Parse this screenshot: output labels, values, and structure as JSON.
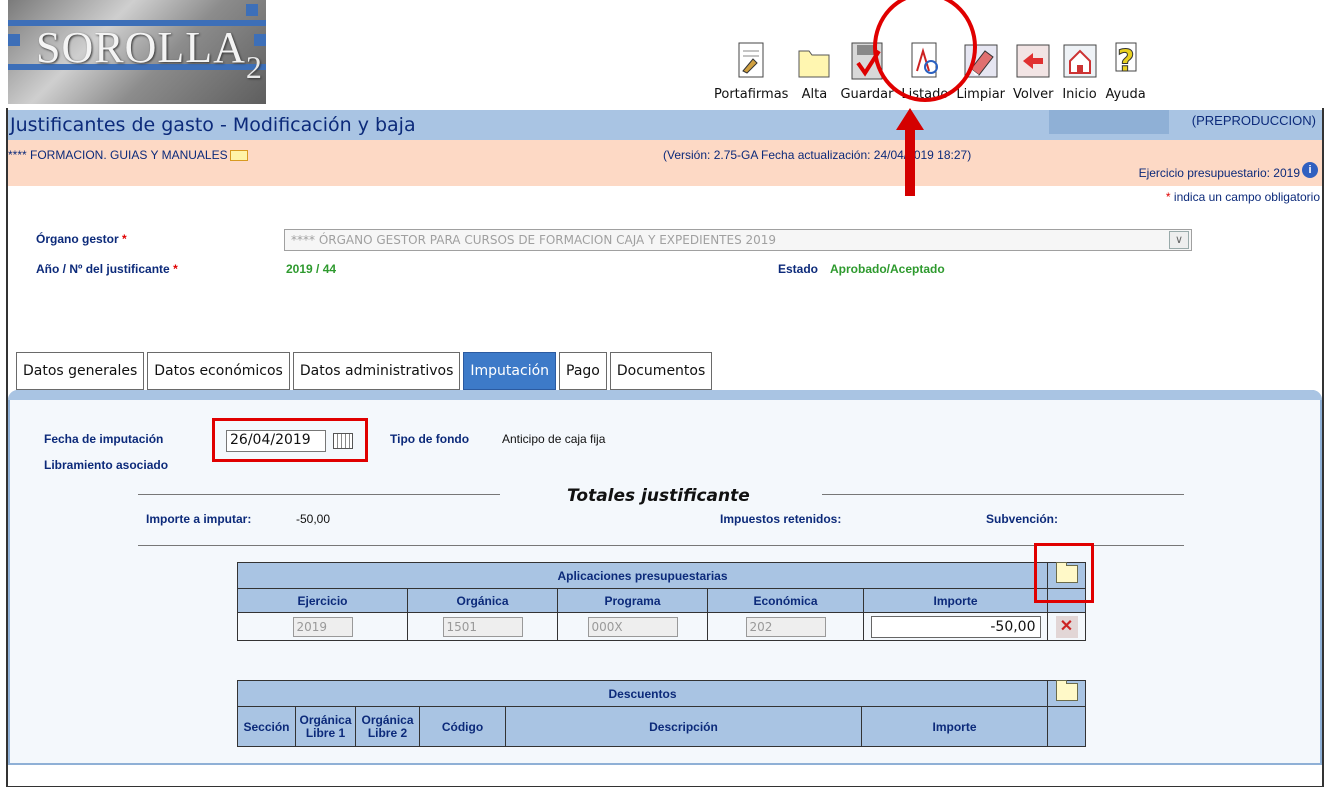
{
  "logo": {
    "text": "SOROLLA",
    "version_mark": "2"
  },
  "toolbar": {
    "items": [
      {
        "label": "Portafirmas",
        "icon": "signature-pad-icon"
      },
      {
        "label": "Alta",
        "icon": "folder-icon"
      },
      {
        "label": "Guardar",
        "icon": "save-check-icon"
      },
      {
        "label": "Listado",
        "icon": "document-list-icon"
      },
      {
        "label": "Limpiar",
        "icon": "eraser-icon"
      },
      {
        "label": "Volver",
        "icon": "back-arrow-icon"
      },
      {
        "label": "Inicio",
        "icon": "home-icon"
      },
      {
        "label": "Ayuda",
        "icon": "help-icon"
      }
    ]
  },
  "title": {
    "text": "Justificantes de gasto - Modificación y baja",
    "environment": "(PREPRODUCCION)"
  },
  "info": {
    "user_text": "**** FORMACION. GUIAS Y MANUALES",
    "version": "(Versión: 2.75-GA Fecha actualización: 24/04/2019 18:27)",
    "ejercicio": "Ejercicio presupuestario: 2019",
    "info_icon": "i",
    "obligatorio_star": "*",
    "obligatorio_text": "indica un campo obligatorio"
  },
  "form": {
    "organo_label": "Órgano gestor",
    "organo_value": "**** ÓRGANO GESTOR PARA CURSOS DE FORMACION CAJA Y EXPEDIENTES 2019",
    "anio_label": "Año / Nº del justificante",
    "anio_value": "2019 / 44",
    "estado_label": "Estado",
    "estado_value": "Aprobado/Aceptado",
    "required_star": "*"
  },
  "tabs": [
    {
      "label": "Datos generales",
      "active": false
    },
    {
      "label": "Datos económicos",
      "active": false
    },
    {
      "label": "Datos administrativos",
      "active": false
    },
    {
      "label": "Imputación",
      "active": true
    },
    {
      "label": "Pago",
      "active": false
    },
    {
      "label": "Documentos",
      "active": false
    }
  ],
  "imputacion": {
    "fecha_label": "Fecha de imputación",
    "fecha_value": "26/04/2019",
    "tipo_label": "Tipo de fondo",
    "tipo_value": "Anticipo de caja fija",
    "libramiento_label": "Libramiento asociado",
    "totales_title": "Totales justificante",
    "importe_label": "Importe a imputar:",
    "importe_value": "-50,00",
    "impuestos_label": "Impuestos retenidos:",
    "subvencion_label": "Subvención:"
  },
  "aplicaciones": {
    "caption": "Aplicaciones presupuestarias",
    "headers": [
      "Ejercicio",
      "Orgánica",
      "Programa",
      "Económica",
      "Importe"
    ],
    "row": {
      "ejercicio": "2019",
      "organica": "1501",
      "programa": "000X",
      "economica": "202",
      "importe": "-50,00"
    }
  },
  "descuentos": {
    "caption": "Descuentos",
    "headers": {
      "seccion": "Sección",
      "org1_a": "Orgánica",
      "org1_b": "Libre 1",
      "org2_a": "Orgánica",
      "org2_b": "Libre 2",
      "codigo": "Código",
      "descripcion": "Descripción",
      "importe": "Importe"
    }
  },
  "colors": {
    "title_blue": "#0c2a7a",
    "header_bar": "#a9c4e3",
    "info_bar": "#fdd9c5",
    "active_tab": "#3d7ac8",
    "status_green": "#2e9a2e",
    "highlight_red": "#e00000"
  }
}
